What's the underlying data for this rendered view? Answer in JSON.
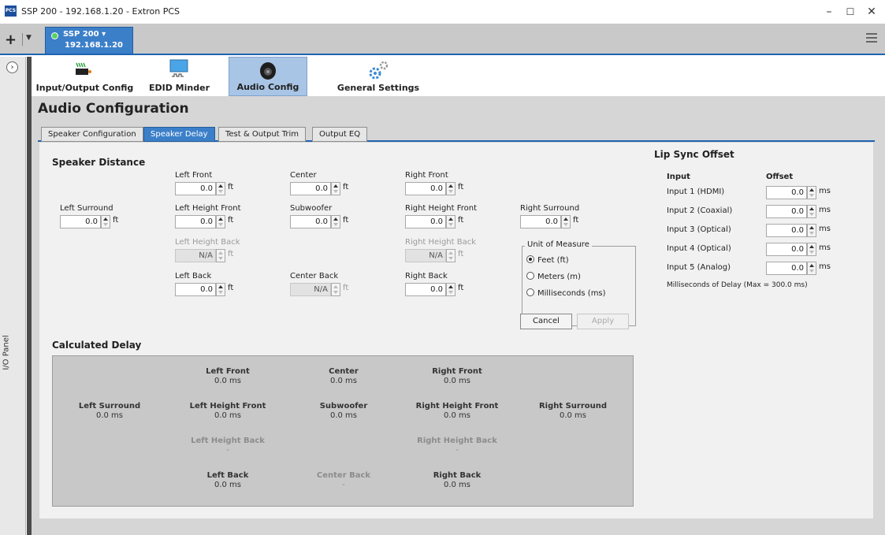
{
  "window": {
    "logo_text": "PCS",
    "title": "SSP 200 - 192.168.1.20 - Extron PCS",
    "minimize": "–",
    "maximize": "☐",
    "close": "✕"
  },
  "device_tab": {
    "name": "SSP 200 ▾",
    "ip": "192.168.1.20",
    "status_color": "#57d15f"
  },
  "side_panel": {
    "label": "I/O Panel"
  },
  "toolbar": [
    {
      "label": "Input/Output Config",
      "icon": "io-config-icon",
      "active": false
    },
    {
      "label": "EDID Minder",
      "icon": "edid-monitor-icon",
      "active": false
    },
    {
      "label": "Audio Config",
      "icon": "speaker-icon",
      "active": true
    },
    {
      "label": "General Settings",
      "icon": "gears-icon",
      "active": false
    }
  ],
  "page": {
    "title": "Audio Configuration",
    "subtabs": [
      "Speaker Configuration",
      "Speaker Delay",
      "Test & Output Trim",
      "Output EQ"
    ],
    "active_subtab": "Speaker Delay"
  },
  "speaker_distance": {
    "heading": "Speaker Distance",
    "unit": "ft",
    "fields": {
      "left_front": {
        "label": "Left Front",
        "value": "0.0"
      },
      "center": {
        "label": "Center",
        "value": "0.0"
      },
      "right_front": {
        "label": "Right Front",
        "value": "0.0"
      },
      "left_surround": {
        "label": "Left Surround",
        "value": "0.0"
      },
      "left_height_front": {
        "label": "Left Height Front",
        "value": "0.0"
      },
      "subwoofer": {
        "label": "Subwoofer",
        "value": "0.0"
      },
      "right_height_front": {
        "label": "Right Height Front",
        "value": "0.0"
      },
      "right_surround": {
        "label": "Right Surround",
        "value": "0.0"
      },
      "left_height_back": {
        "label": "Left Height Back",
        "value": "N/A"
      },
      "right_height_back": {
        "label": "Right Height Back",
        "value": "N/A"
      },
      "left_back": {
        "label": "Left Back",
        "value": "0.0"
      },
      "center_back": {
        "label": "Center Back",
        "value": "N/A"
      },
      "right_back": {
        "label": "Right Back",
        "value": "0.0"
      }
    }
  },
  "unit_of_measure": {
    "legend": "Unit of Measure",
    "options": [
      "Feet (ft)",
      "Meters (m)",
      "Milliseconds (ms)"
    ],
    "selected": "Feet (ft)"
  },
  "buttons": {
    "cancel": "Cancel",
    "apply": "Apply"
  },
  "calculated_delay": {
    "heading": "Calculated Delay",
    "cells": {
      "left_front": {
        "label": "Left Front",
        "value": "0.0 ms"
      },
      "center": {
        "label": "Center",
        "value": "0.0 ms"
      },
      "right_front": {
        "label": "Right Front",
        "value": "0.0 ms"
      },
      "left_surround": {
        "label": "Left Surround",
        "value": "0.0 ms"
      },
      "left_height_front": {
        "label": "Left Height Front",
        "value": "0.0 ms"
      },
      "subwoofer": {
        "label": "Subwoofer",
        "value": "0.0 ms"
      },
      "right_height_front": {
        "label": "Right Height Front",
        "value": "0.0 ms"
      },
      "right_surround": {
        "label": "Right Surround",
        "value": "0.0 ms"
      },
      "left_height_back": {
        "label": "Left Height Back",
        "value": "-"
      },
      "right_height_back": {
        "label": "Right Height Back",
        "value": "-"
      },
      "left_back": {
        "label": "Left Back",
        "value": "0.0 ms"
      },
      "center_back": {
        "label": "Center Back",
        "value": "-"
      },
      "right_back": {
        "label": "Right Back",
        "value": "0.0 ms"
      }
    }
  },
  "lip_sync": {
    "heading": "Lip Sync Offset",
    "col_input": "Input",
    "col_offset": "Offset",
    "unit": "ms",
    "rows": [
      {
        "input": "Input 1 (HDMI)",
        "value": "0.0"
      },
      {
        "input": "Input 2 (Coaxial)",
        "value": "0.0"
      },
      {
        "input": "Input 3 (Optical)",
        "value": "0.0"
      },
      {
        "input": "Input 4 (Optical)",
        "value": "0.0"
      },
      {
        "input": "Input 5 (Analog)",
        "value": "0.0"
      }
    ],
    "note": "Milliseconds of Delay (Max = 300.0 ms)"
  },
  "colors": {
    "accent": "#3b7fc9",
    "tab_border": "#1f63b2",
    "active_tool": "#a9c5e6"
  }
}
